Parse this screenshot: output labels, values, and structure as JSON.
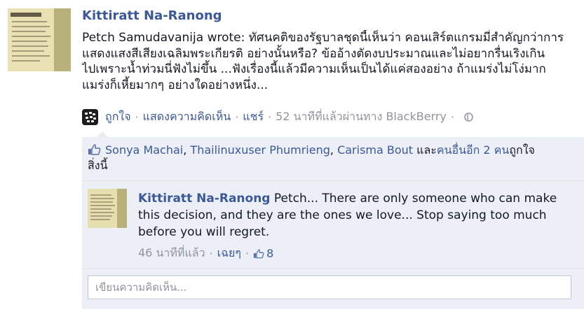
{
  "post": {
    "author": "Kittiratt Na-Ranong",
    "text_lines": [
      "Petch Samudavanija wrote: ทัศนคติของรัฐบาลชุดนี้เห็นว่า คอนเสิร์ตแกรมมี่สำคัญกว่าการ",
      "แสดงแสงสีเสียงเฉลิมพระเกียรติ อย่างนั้นหรือ? ข้ออ้างตัดงบประมาณและไม่อยากรื่นเริงเกิน",
      "ไปเพราะน้ำท่วมนี่ฟังไม่ขึ้น ...ฟังเรื่องนี้แล้วมีความเห็นเป็นได้แค่สองอย่าง ถ้าแมร่งไม่โง่มาก",
      "แมร่งก็เหี้ยมากๆ อย่างใดอย่างหนึ่ง..."
    ],
    "meta": {
      "like": "ถูกใจ",
      "comment": "แสดงความคิดเห็น",
      "share": "แชร์",
      "time_via": "52 นาทีที่แล้วผ่านทาง BlackBerry",
      "separator": "·"
    }
  },
  "likes": {
    "names": [
      "Sonya Machai",
      "Thailinuxuser Phumrieng",
      "Carisma Bout"
    ],
    "comma": ", ",
    "and_text": " และ",
    "others_link": "คนอื่นอีก 2 คน",
    "suffix": "ถูกใจสิ่งนี้"
  },
  "comment": {
    "author": "Kittiratt Na-Ranong",
    "text": " Petch... There are only someone who can make this decision, and they are the ones we love... Stop saying too much before you will regret.",
    "time": "46 นาทีที่แล้ว",
    "reply": "เฉยๆ",
    "like_count": "8",
    "separator": "·"
  },
  "reply_input": {
    "placeholder": "เขียนความคิดเห็น..."
  },
  "colors": {
    "link": "#3b5998",
    "ufi_bg": "#eceff5",
    "meta": "#90949c"
  }
}
